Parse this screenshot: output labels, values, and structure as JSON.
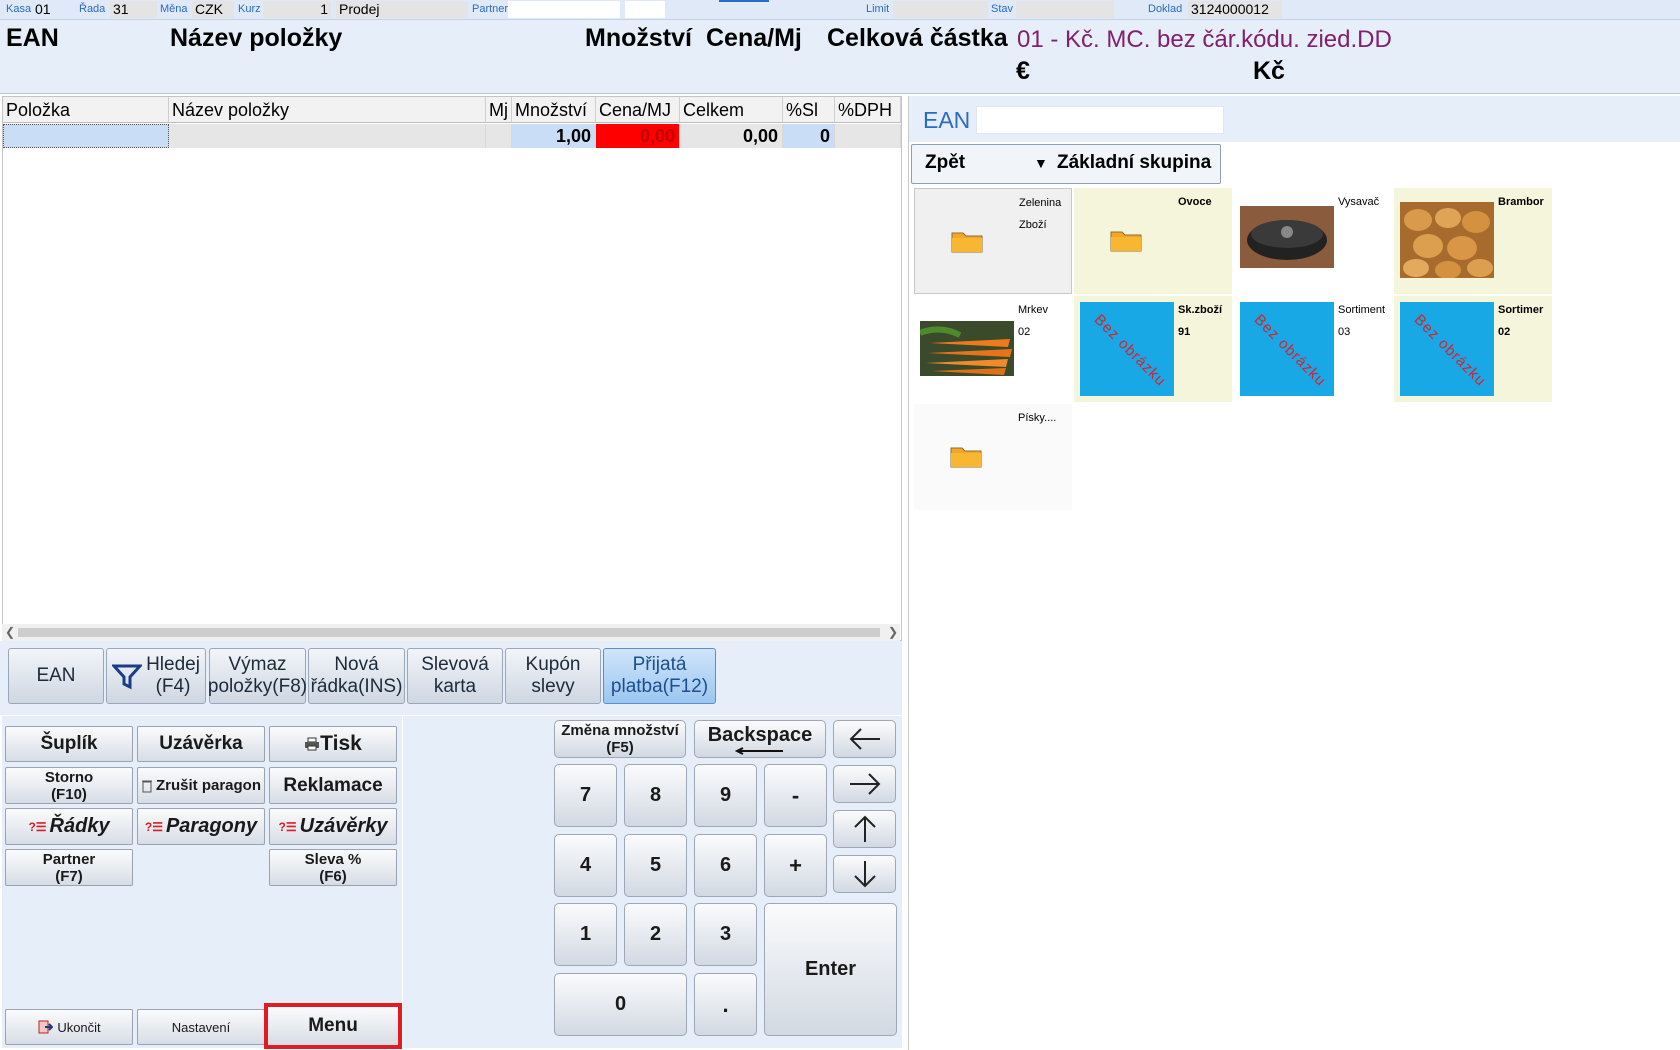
{
  "topbar": {
    "kasa_label": "Kasa",
    "kasa_value": "01",
    "rada_label": "Řada",
    "rada_value": "31",
    "mena_label": "Měna",
    "mena_value": "CZK",
    "kurz_label": "Kurz",
    "kurz_value": "1",
    "mode_value": "Prodej",
    "partner_label": "Partner",
    "limit_label": "Limit",
    "stav_label": "Stav",
    "doklad_label": "Doklad",
    "doklad_value": "3124000012"
  },
  "header": {
    "ean": "EAN",
    "nazev": "Název položky",
    "mnozstvi": "Množství",
    "cena": "Cena/Mj",
    "celkova": "Celková částka",
    "info": "01 - Kč. MC. bez čár.kódu. zied.DD",
    "currency_eur": "€",
    "currency_kc": "Kč"
  },
  "grid": {
    "columns": [
      "Položka",
      "Název položky",
      "Mj",
      "Množství",
      "Cena/MJ",
      "Celkem",
      "%Sl",
      "%DPH"
    ],
    "row": {
      "polozka": "",
      "nazev": "",
      "mj": "",
      "mnozstvi": "1,00",
      "cena": "0,00",
      "celkem": "0,00",
      "sleva": "0",
      "dph": ""
    }
  },
  "toolbar": {
    "ean": "EAN",
    "hledej_1": "Hledej",
    "hledej_2": "(F4)",
    "vymaz_1": "Výmaz",
    "vymaz_2": "položky(F8)",
    "nova_1": "Nová",
    "nova_2": "řádka(INS)",
    "slevova_1": "Slevová",
    "slevova_2": "karta",
    "kupon_1": "Kupón",
    "kupon_2": "slevy",
    "prijata_1": "Přijatá",
    "prijata_2": "platba(F12)"
  },
  "actions": {
    "suplik": "Šuplík",
    "uzaverka": "Uzávěrka",
    "tisk": "Tisk",
    "storno_1": "Storno",
    "storno_2": "(F10)",
    "zrusit": "Zrušit paragon",
    "reklamace": "Reklamace",
    "radky": "Řádky",
    "paragony": "Paragony",
    "uzaverky": "Uzávěrky",
    "partner_1": "Partner",
    "partner_2": "(F7)",
    "sleva_1": "Sleva %",
    "sleva_2": "(F6)",
    "ukoncit": "Ukončit",
    "nastaveni": "Nastavení",
    "menu": "Menu"
  },
  "keypad": {
    "zmena_1": "Změna množství",
    "zmena_2": "(F5)",
    "backspace": "Backspace",
    "k7": "7",
    "k8": "8",
    "k9": "9",
    "minus": "-",
    "k4": "4",
    "k5": "5",
    "k6": "6",
    "plus": "+",
    "k1": "1",
    "k2": "2",
    "k3": "3",
    "enter": "Enter",
    "k0": "0",
    "dot": "."
  },
  "right": {
    "ean_label": "EAN",
    "back": "Zpět",
    "group": "Základní skupina",
    "no_image": "Bez obrázku"
  },
  "tiles": [
    {
      "name": "Zelenina",
      "code": "Zboží"
    },
    {
      "name": "Ovoce",
      "code": ""
    },
    {
      "name": "Vysavač",
      "code": ""
    },
    {
      "name": "Brambor",
      "code": ""
    },
    {
      "name": "Mrkev",
      "code": "02"
    },
    {
      "name": "Sk.zboží",
      "code": "91"
    },
    {
      "name": "Sortiment",
      "code": "03"
    },
    {
      "name": "Sortimer",
      "code": "02"
    },
    {
      "name": "Písky....",
      "code": ""
    }
  ],
  "colors": {
    "accent": "#2a6bc4",
    "price_cell": "#ff0000",
    "qty_cell": "#c9def6",
    "menu_outline": "#e01b24",
    "info_text": "#80206e",
    "no_image_bg": "#18a8e6"
  }
}
